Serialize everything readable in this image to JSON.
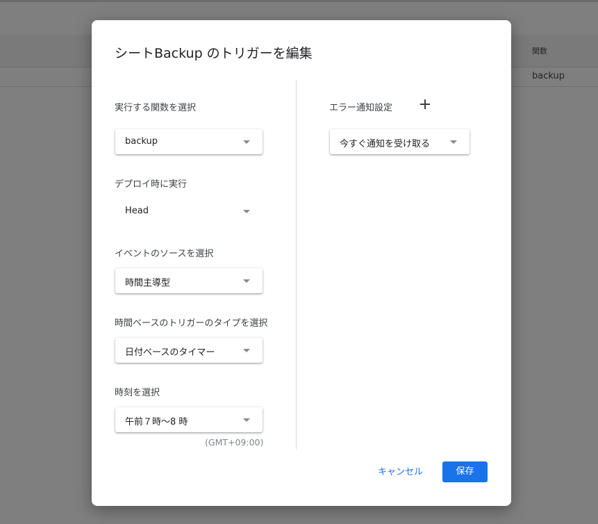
{
  "background": {
    "table_header": "関数",
    "table_row_value": "backup"
  },
  "dialog": {
    "title": "シートBackup のトリガーを編集",
    "fields": {
      "function": {
        "label": "実行する関数を選択",
        "value": "backup"
      },
      "deployment": {
        "label": "デプロイ時に実行",
        "value": "Head"
      },
      "event_source": {
        "label": "イベントのソースを選択",
        "value": "時間主導型"
      },
      "time_trigger_type": {
        "label": "時間ベースのトリガーのタイプを選択",
        "value": "日付ベースのタイマー"
      },
      "time_of_day": {
        "label": "時刻を選択",
        "value": "午前７時〜8 時",
        "timezone": "(GMT+09:00)"
      }
    },
    "error_notification": {
      "label": "エラー通知設定",
      "add_icon": "plus-icon",
      "value": "今すぐ通知を受け取る"
    },
    "buttons": {
      "cancel": "キャンセル",
      "save": "保存"
    },
    "colors": {
      "accent": "#1a73e8",
      "overlay": "#7f7f7f"
    }
  }
}
